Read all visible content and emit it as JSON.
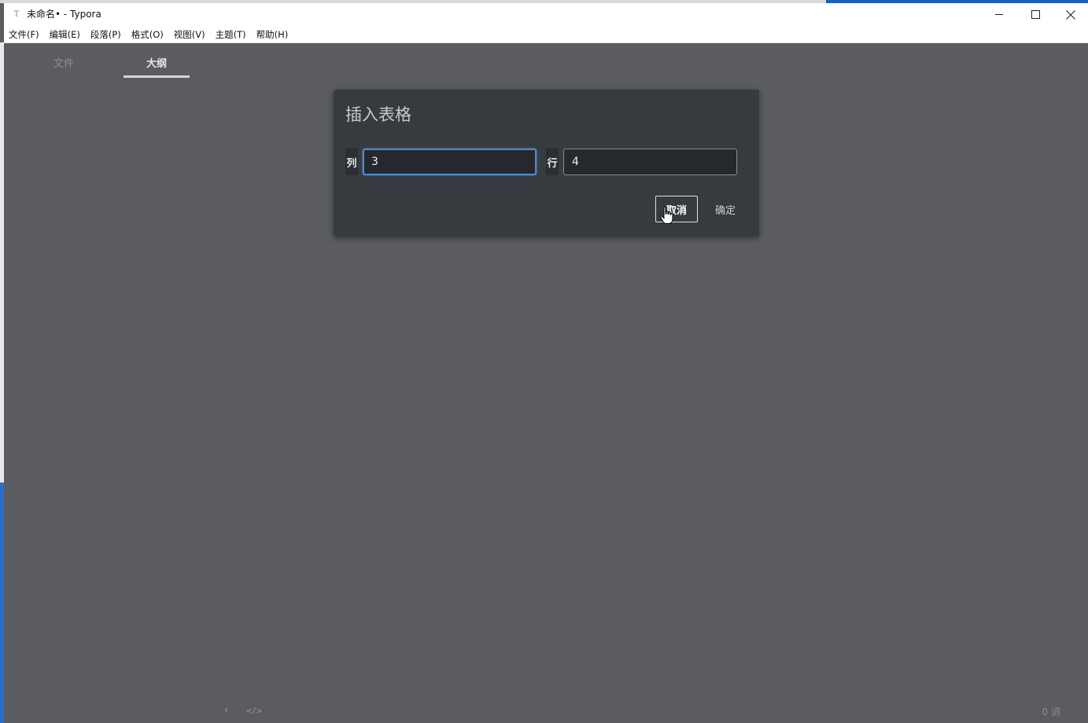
{
  "window": {
    "title": "未命名• - Typora",
    "app_icon": "T",
    "controls": {
      "minimize": "─",
      "maximize": "☐",
      "close": "✕"
    }
  },
  "menu": {
    "items": [
      "文件(F)",
      "编辑(E)",
      "段落(P)",
      "格式(O)",
      "视图(V)",
      "主题(T)",
      "帮助(H)"
    ]
  },
  "sidebar": {
    "tabs": [
      {
        "label": "文件",
        "active": false
      },
      {
        "label": "大纲",
        "active": true
      }
    ]
  },
  "dialog": {
    "title": "插入表格",
    "columns_label": "列",
    "columns_value": "3",
    "rows_label": "行",
    "rows_value": "4",
    "cancel_label": "取消",
    "ok_label": "确定"
  },
  "footer": {
    "back_icon": "‹",
    "source_icon": "</>",
    "word_count": "0 词"
  },
  "colors": {
    "editor_background": "#5b5c60",
    "dialog_background": "#363b40",
    "focus_accent": "#4f8ad2"
  }
}
